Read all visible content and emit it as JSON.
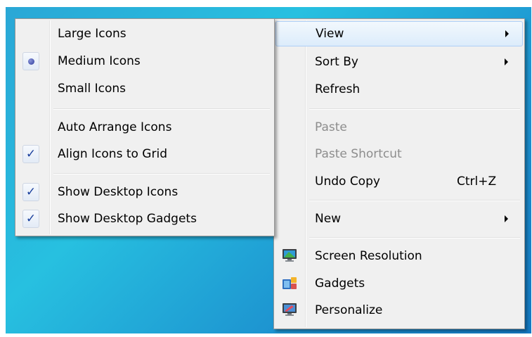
{
  "context_menu": {
    "items": [
      {
        "label": "View",
        "has_submenu": true
      },
      {
        "label": "Sort By",
        "has_submenu": true
      },
      {
        "label": "Refresh"
      },
      {
        "label": "Paste",
        "disabled": true
      },
      {
        "label": "Paste Shortcut",
        "disabled": true
      },
      {
        "label": "Undo Copy",
        "shortcut": "Ctrl+Z"
      },
      {
        "label": "New",
        "has_submenu": true
      },
      {
        "label": "Screen Resolution",
        "icon": "monitor-icon"
      },
      {
        "label": "Gadgets",
        "icon": "gadgets-icon"
      },
      {
        "label": "Personalize",
        "icon": "personalize-icon"
      }
    ]
  },
  "view_submenu": {
    "items": [
      {
        "label": "Large Icons"
      },
      {
        "label": "Medium Icons",
        "state": "radio-selected"
      },
      {
        "label": "Small Icons"
      },
      {
        "label": "Auto Arrange Icons"
      },
      {
        "label": "Align Icons to Grid",
        "state": "checked"
      },
      {
        "label": "Show Desktop Icons",
        "state": "checked"
      },
      {
        "label": "Show Desktop Gadgets",
        "state": "checked"
      }
    ],
    "check_glyph": "✓"
  },
  "colors": {
    "menu_background": "#f0f0f0",
    "highlight": "#dcecfb",
    "disabled_text": "#8d8d8d",
    "desktop": "#27c0e0"
  }
}
